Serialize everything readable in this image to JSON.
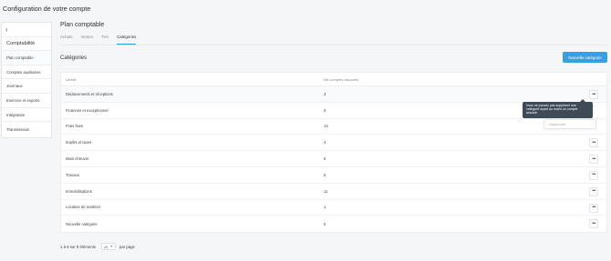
{
  "page": {
    "title": "Configuration de votre compte"
  },
  "sidebar": {
    "back_icon": "chevron-left-icon",
    "section": "Comptabilité",
    "items": [
      {
        "label": "Plan comptable",
        "active": true
      },
      {
        "label": "Comptes auxiliaires"
      },
      {
        "label": "Journaux"
      },
      {
        "label": "Exercice et exports"
      },
      {
        "label": "Intégration"
      },
      {
        "label": "Transmission"
      }
    ]
  },
  "main": {
    "title": "Plan comptable",
    "tabs": [
      {
        "label": "Achats"
      },
      {
        "label": "Ventes"
      },
      {
        "label": "TVA"
      },
      {
        "label": "Catégories",
        "active": true
      }
    ],
    "section_title": "Catégories",
    "new_button": "Nouvelle catégorie"
  },
  "table": {
    "headers": [
      "Libellé",
      "Nb comptes associés"
    ],
    "rows": [
      {
        "label": "Déplacements et réceptions",
        "count": "3"
      },
      {
        "label": "Financier et exceptionnel",
        "count": "5"
      },
      {
        "label": "Frais fixes",
        "count": "14"
      },
      {
        "label": "Impôts et taxes",
        "count": "4"
      },
      {
        "label": "Main d'œuvre",
        "count": "6"
      },
      {
        "label": "Travaux",
        "count": "5"
      },
      {
        "label": "Immobilisations",
        "count": "11"
      },
      {
        "label": "Location de matériel",
        "count": "1"
      },
      {
        "label": "Nouvelle catégorie",
        "count": "0"
      }
    ],
    "more_icon": "ellipsis-icon"
  },
  "tooltip": {
    "text": "Vous ne pouvez pas supprimer une catégorie ayant au moins un compte associé."
  },
  "dropdown": {
    "item": "Supprimer"
  },
  "pagination": {
    "summary": "1 à 9 sur 9 éléments",
    "per_page_value": "25",
    "per_page_label": "par page"
  },
  "colors": {
    "accent": "#3a9fe0",
    "tooltip_bg": "#3f4a57",
    "background": "#f5f6f8"
  }
}
